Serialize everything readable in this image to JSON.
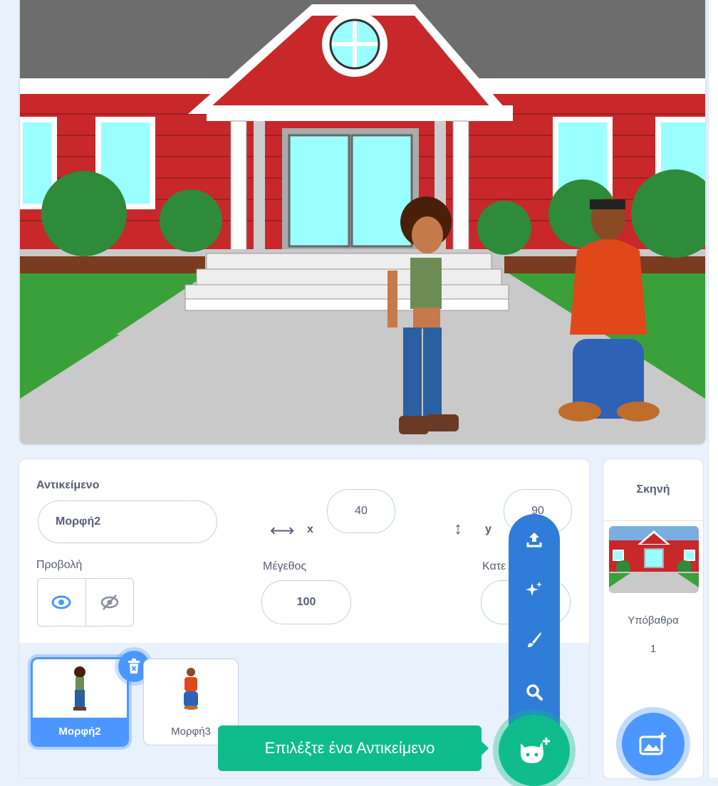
{
  "sprite_info": {
    "sprite_label": "Αντικείμενο",
    "sprite_name": "Μορφή2",
    "x_label": "x",
    "x_value": "40",
    "y_label": "y",
    "y_value": "90",
    "show_label": "Προβολή",
    "size_label": "Μέγεθος",
    "size_value": "100",
    "direction_label": "Κατε"
  },
  "sprites": [
    {
      "name": "Μορφή2",
      "selected": true
    },
    {
      "name": "Μορφή3",
      "selected": false
    }
  ],
  "stage_panel": {
    "title": "Σκηνή",
    "backdrops_label": "Υπόβαθρα",
    "backdrops_count": "1"
  },
  "sprite_menu": {
    "items": [
      "upload-icon",
      "surprise-icon",
      "paint-icon",
      "search-icon"
    ],
    "main_icon": "cat-plus-icon",
    "tooltip": "Επιλέξτε ένα Αντικείμενο"
  },
  "colors": {
    "accent": "#4c97ff",
    "fab_green": "#0fbd8c",
    "menu_blue": "#2f7dd9"
  }
}
